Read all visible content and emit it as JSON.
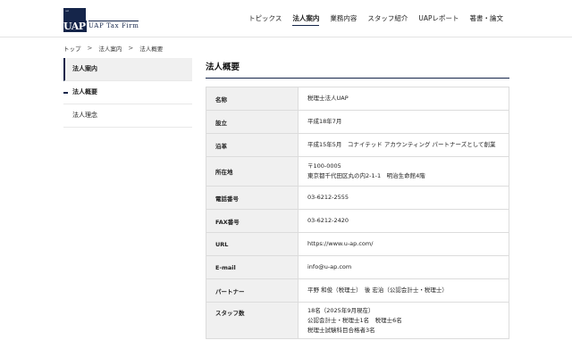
{
  "header": {
    "logo": {
      "mark": "UAP",
      "tiny": "UAP",
      "text": "UAP Tax Firm"
    },
    "nav": [
      {
        "label": "トピックス",
        "active": false
      },
      {
        "label": "法人案内",
        "active": true
      },
      {
        "label": "業務内容",
        "active": false
      },
      {
        "label": "スタッフ紹介",
        "active": false
      },
      {
        "label": "UAPレポート",
        "active": false
      },
      {
        "label": "著書・論文",
        "active": false
      }
    ]
  },
  "breadcrumb": {
    "items": [
      "トップ",
      "法人案内",
      "法人概要"
    ],
    "separator": ">"
  },
  "sidebar": {
    "items": [
      {
        "label": "法人案内",
        "type": "heading"
      },
      {
        "label": "法人概要",
        "type": "current"
      },
      {
        "label": "法人理念",
        "type": "link"
      }
    ]
  },
  "main": {
    "title": "法人概要",
    "rows": [
      {
        "label": "名称",
        "lines": [
          "税理士法人UAP"
        ]
      },
      {
        "label": "設立",
        "lines": [
          "平成18年7月"
        ]
      },
      {
        "label": "沿革",
        "lines": [
          "平成15年5月　コナイテッド アカウンティング パートナーズとして創業"
        ]
      },
      {
        "label": "所在地",
        "lines": [
          "〒100-0005",
          "東京都千代田区丸の内2-1-1　明治生命館4階"
        ]
      },
      {
        "label": "電話番号",
        "lines": [
          "03-6212-2555"
        ]
      },
      {
        "label": "FAX番号",
        "lines": [
          "03-6212-2420"
        ]
      },
      {
        "label": "URL",
        "lines": [
          "https://www.u-ap.com/"
        ]
      },
      {
        "label": "E-mail",
        "lines": [
          "info@u-ap.com"
        ]
      },
      {
        "label": "パートナー",
        "lines": [
          "平野 和俊（税理士）　後 宏治（公認会計士・税理士）"
        ]
      },
      {
        "label": "スタッフ数",
        "lines": [
          "18名（2025年9月現在）",
          "公認会計士・税理士1名　税理士6名",
          "税理士試験科目合格者3名"
        ]
      }
    ]
  },
  "colors": {
    "accent": "#15254a",
    "label_bg": "#f0f0f0",
    "border": "#dcdcdc"
  }
}
